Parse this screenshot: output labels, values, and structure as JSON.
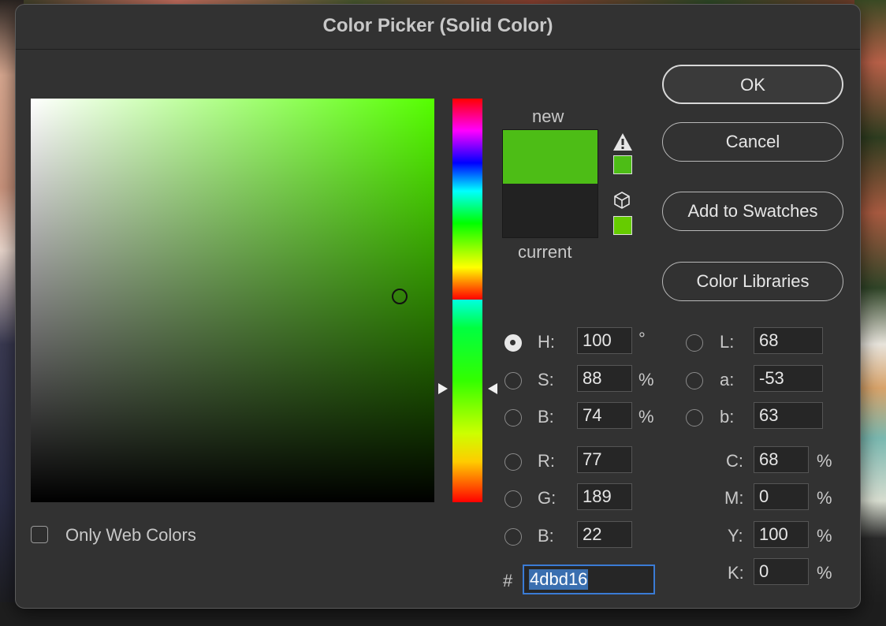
{
  "title": "Color Picker (Solid Color)",
  "swatch": {
    "new_label": "new",
    "current_label": "current",
    "new_color": "#4dbd16",
    "current_color": "#222222"
  },
  "gamut": {
    "warning_swatch": "#4dbd16",
    "web_safe_swatch": "#66cc00"
  },
  "buttons": {
    "ok": "OK",
    "cancel": "Cancel",
    "add_swatches": "Add to Swatches",
    "libraries": "Color Libraries"
  },
  "hsb": [
    {
      "label": "H:",
      "value": "100",
      "unit": "°",
      "selected": true
    },
    {
      "label": "S:",
      "value": "88",
      "unit": "%",
      "selected": false
    },
    {
      "label": "B:",
      "value": "74",
      "unit": "%",
      "selected": false
    }
  ],
  "rgb": [
    {
      "label": "R:",
      "value": "77"
    },
    {
      "label": "G:",
      "value": "189"
    },
    {
      "label": "B:",
      "value": "22"
    }
  ],
  "lab": [
    {
      "label": "L:",
      "value": "68"
    },
    {
      "label": "a:",
      "value": "-53"
    },
    {
      "label": "b:",
      "value": "63"
    }
  ],
  "cmyk": [
    {
      "label": "C:",
      "value": "68",
      "unit": "%"
    },
    {
      "label": "M:",
      "value": "0",
      "unit": "%"
    },
    {
      "label": "Y:",
      "value": "100",
      "unit": "%"
    },
    {
      "label": "K:",
      "value": "0",
      "unit": "%"
    }
  ],
  "hex": {
    "prefix": "#",
    "value": "4dbd16"
  },
  "web_colors_label": "Only Web Colors",
  "web_colors_checked": false
}
